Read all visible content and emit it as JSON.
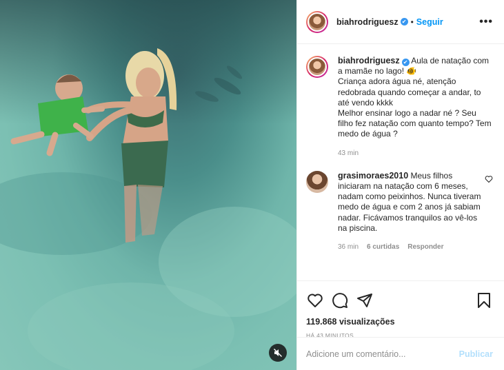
{
  "post": {
    "author": "biahrodriguesz",
    "verified_mark": "✔",
    "dot": "•",
    "follow_label": "Seguir",
    "more_label": "•••"
  },
  "caption": {
    "author": "biahrodriguesz",
    "text": "Aula de natação com a mamãe no lago! 🐠\nCriança adora água né, atenção redobrada quando começar a andar, to até vendo kkkk\nMelhor ensinar logo a nadar né ? Seu filho fez natação com quanto tempo? Tem medo de água ?",
    "time": "43 min"
  },
  "comments": [
    {
      "author": "grasimoraes2010",
      "text": "Meus filhos iniciaram na natação com 6 meses, nadam como peixinhos. Nunca tiveram medo de água e com 2 anos já sabiam nadar. Ficávamos tranquilos ao vê-los na piscina.",
      "time": "36 min",
      "likes": "6 curtidas",
      "reply_label": "Responder"
    }
  ],
  "stats": {
    "views": "119.868 visualizações",
    "time_ago": "HÁ 43 MINUTOS"
  },
  "composer": {
    "placeholder": "Adicione um comentário...",
    "publish_label": "Publicar"
  },
  "icons": {
    "like": "heart-icon",
    "comment": "comment-icon",
    "share": "share-icon",
    "save": "bookmark-icon",
    "mute": "muted-speaker-icon"
  },
  "colors": {
    "link": "#0095f6",
    "verified": "#3897f0",
    "muted_text": "#8e8e8e",
    "publish_disabled": "#b2dffc"
  }
}
